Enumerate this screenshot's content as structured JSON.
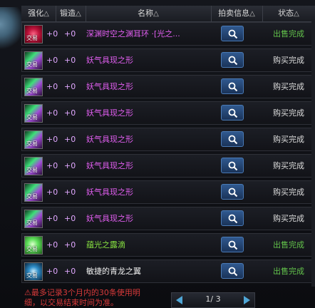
{
  "header": {
    "cols": [
      {
        "label": "强化",
        "tri": "△"
      },
      {
        "label": "锻造",
        "tri": "△"
      },
      {
        "label": "名称",
        "tri": "△"
      },
      {
        "label": "拍卖信息",
        "tri": "△"
      },
      {
        "label": "状态",
        "tri": "△"
      }
    ]
  },
  "rows": [
    {
      "enhance": "+0",
      "forge": "+0",
      "name": "深渊时空之渊耳环 ·[光之...",
      "status": "出售完成",
      "tag": "交易",
      "icon": "earring-icon"
    },
    {
      "enhance": "+0",
      "forge": "+0",
      "name": "妖气具现之形",
      "status": "购买完成",
      "tag": "交易",
      "icon": "potion-icon"
    },
    {
      "enhance": "+0",
      "forge": "+0",
      "name": "妖气具现之形",
      "status": "购买完成",
      "tag": "交易",
      "icon": "potion-icon"
    },
    {
      "enhance": "+0",
      "forge": "+0",
      "name": "妖气具现之形",
      "status": "购买完成",
      "tag": "交易",
      "icon": "potion-icon"
    },
    {
      "enhance": "+0",
      "forge": "+0",
      "name": "妖气具现之形",
      "status": "购买完成",
      "tag": "交易",
      "icon": "potion-icon"
    },
    {
      "enhance": "+0",
      "forge": "+0",
      "name": "妖气具现之形",
      "status": "购买完成",
      "tag": "交易",
      "icon": "potion-icon"
    },
    {
      "enhance": "+0",
      "forge": "+0",
      "name": "妖气具现之形",
      "status": "购买完成",
      "tag": "交易",
      "icon": "potion-icon"
    },
    {
      "enhance": "+0",
      "forge": "+0",
      "name": "妖气具现之形",
      "status": "购买完成",
      "tag": "交易",
      "icon": "potion-icon"
    },
    {
      "enhance": "+0",
      "forge": "+0",
      "name": "蕴光之露滴",
      "status": "出售完成",
      "tag": "交易",
      "icon": "dew-icon"
    },
    {
      "enhance": "+0",
      "forge": "+0",
      "name": "敏捷的青龙之翼",
      "status": "出售完成",
      "tag": "交易",
      "icon": "wing-icon"
    }
  ],
  "footer": {
    "note": "最多记录3个月内的30条使用明细，以交易结束时间为准。",
    "page": "1/ 3"
  },
  "colors": {
    "name_purple": "#e15ef0",
    "name_green": "#86e040",
    "status_sold": "#63c34b",
    "status_bought": "#dcdcdc"
  }
}
